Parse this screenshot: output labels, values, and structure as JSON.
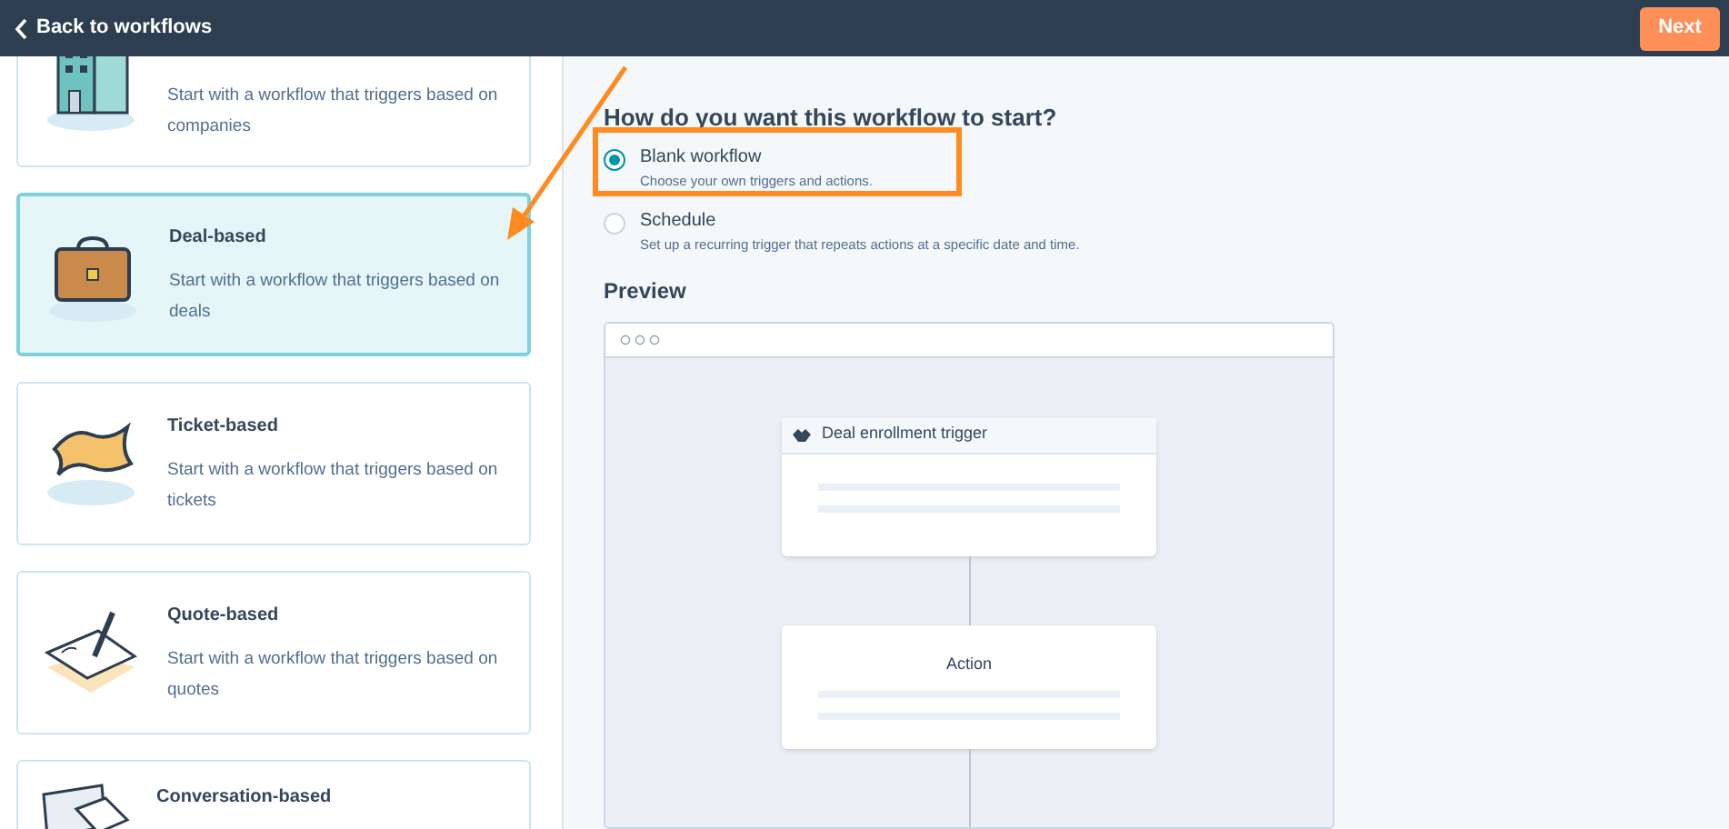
{
  "header": {
    "back_link": "Back to workflows",
    "next_button": "Next"
  },
  "cards": [
    {
      "description": "Start with a workflow that triggers based on companies",
      "selected": false
    },
    {
      "title": "Deal-based",
      "description": "Start with a workflow that triggers based on deals",
      "selected": true
    },
    {
      "title": "Ticket-based",
      "description": "Start with a workflow that triggers based on tickets",
      "selected": false
    },
    {
      "title": "Quote-based",
      "description": "Start with a workflow that triggers based on quotes",
      "selected": false
    },
    {
      "title": "Conversation-based",
      "selected": false
    }
  ],
  "start_question": "How do you want this workflow to start?",
  "start_options": [
    {
      "label": "Blank workflow",
      "description": "Choose your own triggers and actions.",
      "selected": true
    },
    {
      "label": "Schedule",
      "description": "Set up a recurring trigger that repeats actions at a specific date and time.",
      "selected": false
    }
  ],
  "preview": {
    "heading": "Preview",
    "trigger_node": "Deal enrollment trigger",
    "action_node": "Action"
  }
}
